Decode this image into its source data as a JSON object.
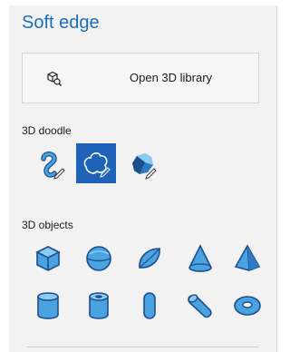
{
  "panel": {
    "title": "Soft edge",
    "library_button": {
      "icon": "3d-library-icon",
      "label": "Open 3D library"
    },
    "doodle": {
      "label": "3D doodle",
      "tools": [
        {
          "icon": "tube-doodle-icon",
          "selected": false
        },
        {
          "icon": "soft-edge-doodle-icon",
          "selected": true
        },
        {
          "icon": "sharp-edge-doodle-icon",
          "selected": false
        }
      ]
    },
    "objects": {
      "label": "3D objects",
      "items": [
        "cube-icon",
        "sphere-icon",
        "hemisphere-icon",
        "cone-icon",
        "pyramid-icon",
        "cylinder-icon",
        "tube-icon",
        "capsule-icon",
        "elbow-pipe-icon",
        "donut-icon"
      ]
    },
    "colors": {
      "accent": "#1a6fb8",
      "selected_bg": "#1e63b8",
      "shape_fill": "#4aa3e0",
      "shape_light": "#8ccaf2",
      "shape_dark": "#1c4f8c"
    }
  }
}
